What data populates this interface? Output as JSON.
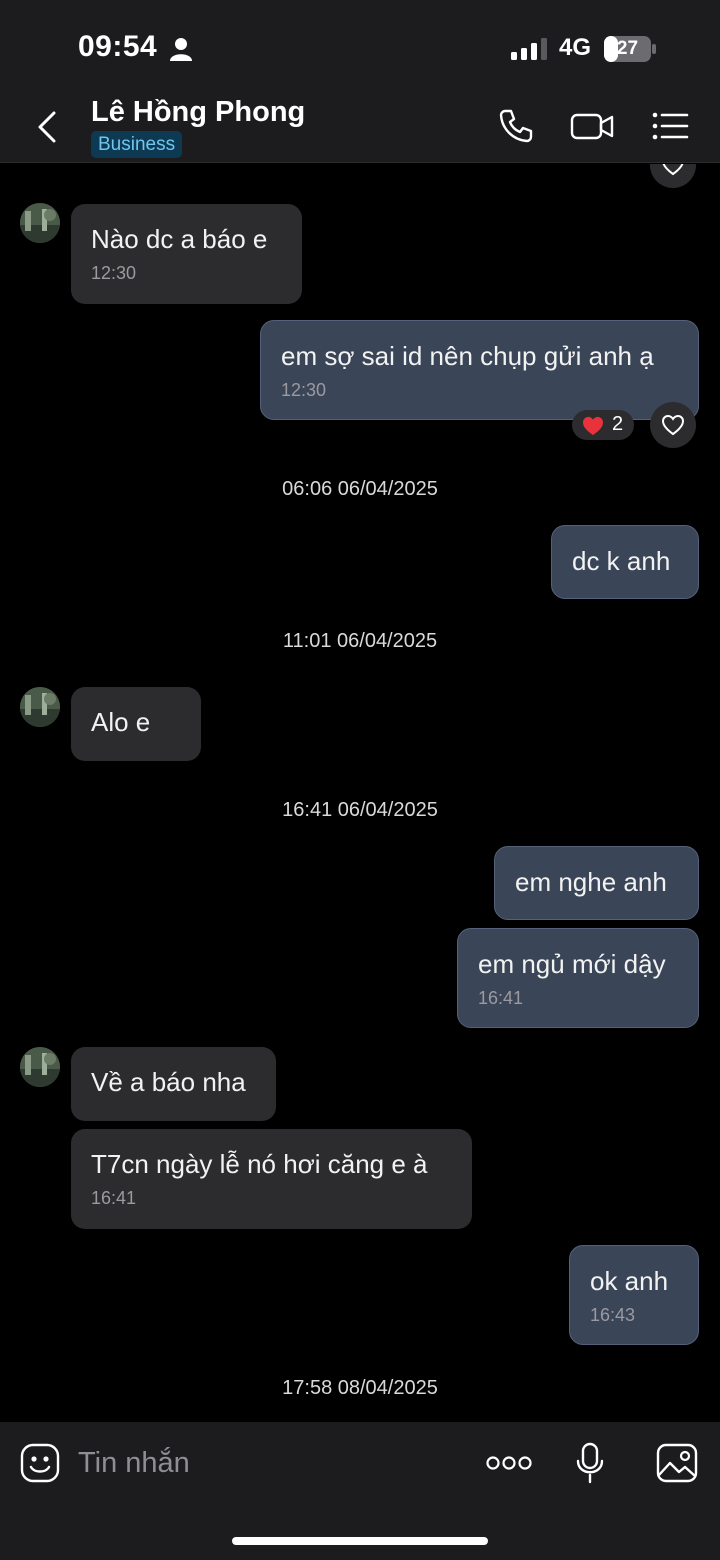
{
  "status_bar": {
    "time": "09:54",
    "network": "4G",
    "battery": "27"
  },
  "header": {
    "contact_name": "Lê Hồng Phong",
    "badge": "Business"
  },
  "chat": {
    "m1": {
      "text": "Nào dc a báo e",
      "time": "12:30"
    },
    "m2": {
      "text": "em sợ sai id nên chụp gửi anh ạ",
      "time": "12:30",
      "reaction_count": "2"
    },
    "d1": "06:06 06/04/2025",
    "m3": {
      "text": "dc k anh"
    },
    "d2": "11:01 06/04/2025",
    "m4": {
      "text": "Alo e"
    },
    "d3": "16:41 06/04/2025",
    "m5": {
      "text": "em nghe anh"
    },
    "m6": {
      "text": "em ngủ mới dậy",
      "time": "16:41"
    },
    "m7": {
      "text": "Về a báo nha"
    },
    "m8": {
      "text": "T7cn ngày lễ nó hơi căng e à",
      "time": "16:41"
    },
    "m9": {
      "text": "ok anh",
      "time": "16:43"
    },
    "d4": "17:58 08/04/2025"
  },
  "composer": {
    "placeholder": "Tin nhắn"
  },
  "icons": {
    "back": "chevron-left-icon",
    "call": "phone-icon",
    "video": "video-camera-icon",
    "menu": "list-icon",
    "sticker": "sticker-icon",
    "more": "more-dots-icon",
    "mic": "microphone-icon",
    "gallery": "image-icon",
    "reaction": "heart-icon",
    "like": "heart-outline-icon"
  },
  "colors": {
    "outgoing_bubble": "#3a4658",
    "incoming_bubble": "#2c2c2e",
    "badge_bg": "#0d3a52",
    "badge_text": "#6fc6ef",
    "reaction": "#e8323c"
  }
}
